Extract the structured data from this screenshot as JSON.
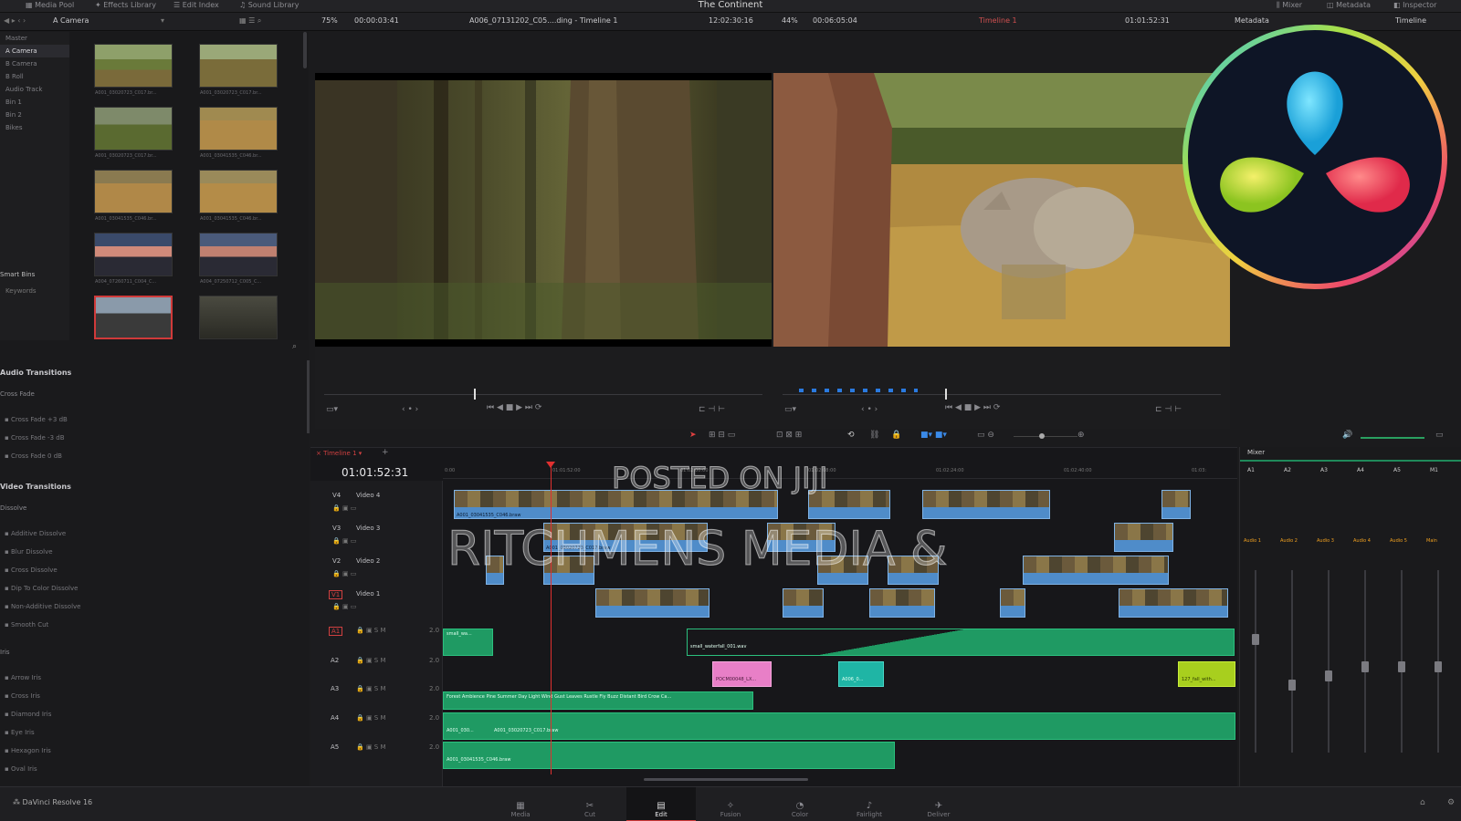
{
  "topbar": {
    "media_pool": "Media Pool",
    "effects_library": "Effects Library",
    "edit_index": "Edit Index",
    "sound_library": "Sound Library",
    "project_title": "The Continent",
    "mixer": "Mixer",
    "metadata": "Metadata",
    "inspector": "Inspector"
  },
  "subbar": {
    "bin_name": "A Camera",
    "source_zoom": "75%",
    "source_tc": "00:00:03:41",
    "source_clip": "A006_07131202_C05....ding - Timeline 1",
    "source_tc2": "12:02:30:16",
    "program_zoom": "44%",
    "program_tc": "00:06:05:04",
    "timeline_name": "Timeline 1",
    "program_tc2": "01:01:52:31",
    "metadata_label": "Metadata",
    "timeline_label": "Timeline"
  },
  "bins": {
    "master": "Master",
    "items": [
      "A Camera",
      "B Camera",
      "B Roll",
      "Audio Track",
      "Bin 1",
      "Bin 2",
      "Bikes"
    ],
    "smart_bins": "Smart Bins",
    "keywords": "Keywords"
  },
  "thumbs": [
    "A001_03020723_C017.br...",
    "A001_03020723_C017.br...",
    "A001_03020723_C017.br...",
    "A001_03041535_C046.br...",
    "A001_03041535_C046.br...",
    "A001_03041535_C046.br...",
    "A004_07260711_C004_C...",
    "A004_07250712_C005_C...",
    "",
    ""
  ],
  "effects": {
    "audio_transitions": "Audio Transitions",
    "cross_fade": "Cross Fade",
    "cross_fade_items": [
      "Cross Fade +3 dB",
      "Cross Fade -3 dB",
      "Cross Fade 0 dB"
    ],
    "video_transitions": "Video Transitions",
    "dissolve": "Dissolve",
    "dissolve_items": [
      "Additive Dissolve",
      "Blur Dissolve",
      "Cross Dissolve",
      "Dip To Color Dissolve",
      "Non-Additive Dissolve",
      "Smooth Cut"
    ],
    "iris": "Iris",
    "iris_items": [
      "Arrow Iris",
      "Cross Iris",
      "Diamond Iris",
      "Eye Iris",
      "Hexagon Iris",
      "Oval Iris"
    ]
  },
  "timeline": {
    "tab": "Timeline 1",
    "timecode": "01:01:52:31",
    "ruler": [
      "0:00",
      "01:01:52:00",
      "01:02:00:00",
      "01:02:08:00",
      "01:02:24:00",
      "01:02:40:00",
      "01:03:"
    ],
    "tracks": [
      {
        "id": "V4",
        "name": "Video 4"
      },
      {
        "id": "V3",
        "name": "Video 3"
      },
      {
        "id": "V2",
        "name": "Video 2"
      },
      {
        "id": "V1",
        "name": "Video 1"
      }
    ],
    "audio_tracks": [
      "A1",
      "A2",
      "A3",
      "A4",
      "A5"
    ],
    "audio_level": "2.0",
    "clip_v4_label": "A001_03041535_C046.braw",
    "clip_v3_label": "A001_03020723_C017.braw",
    "clip_a1_1": "small_wa...",
    "clip_a1_2": "small_waterfall_001.wav",
    "clip_a2_1": "POCM00048_LX...",
    "clip_a2_2": "A006_0...",
    "clip_a2_3": "127_fall_with...",
    "clip_a3": "Forest Ambience Pine Summer Day Light Wind Gust Leaves Rustle Fly Buzz Distant Bird Crow Ca...",
    "clip_a4_1": "A001_030...",
    "clip_a4_2": "A001_03020723_C017.braw",
    "clip_a5": "A001_03041535_C046.braw"
  },
  "mixer": {
    "title": "Mixer",
    "channels": [
      "A1",
      "A2",
      "A3",
      "A4",
      "A5",
      "M1"
    ],
    "buses": [
      "Audio 1",
      "Audio 2",
      "Audio 3",
      "Audio 4",
      "Audio 5",
      "Main"
    ],
    "fader_levels": [
      0.65,
      0.4,
      0.45,
      0.5,
      0.5,
      0.5
    ]
  },
  "footer": {
    "app_name": "DaVinci Resolve 16",
    "pages": [
      "Media",
      "Cut",
      "Edit",
      "Fusion",
      "Color",
      "Fairlight",
      "Deliver"
    ],
    "active_page": "Edit"
  },
  "watermark": {
    "line1": "POSTED ON JIJI",
    "line2": "RITCHMENS MEDIA &"
  },
  "colors": {
    "clip_video": "#4f8cc9",
    "clip_audio": "#1f9a63",
    "clip_pink": "#e87fc7",
    "clip_teal": "#1fb5a5",
    "clip_lime": "#a8cf1e",
    "playhead": "#e03030"
  }
}
